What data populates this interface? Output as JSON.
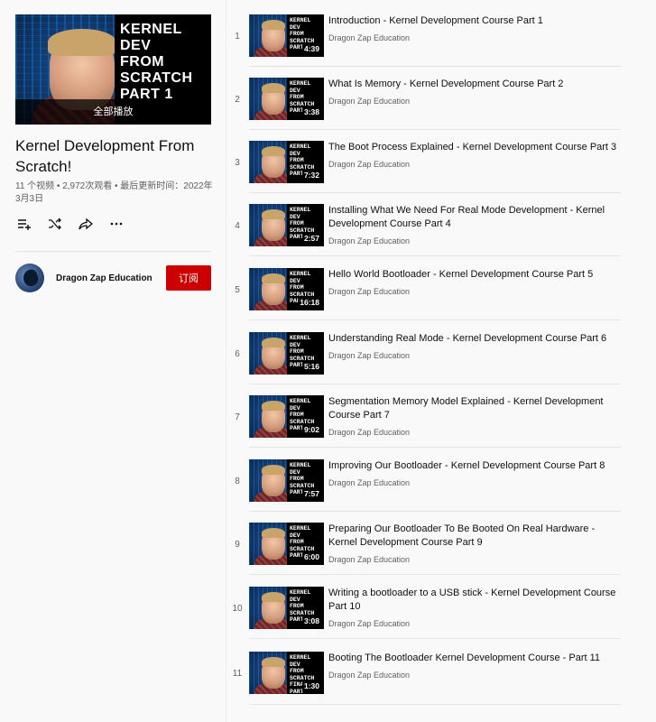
{
  "playlist": {
    "hero_text": "KERNEL\nDEV\nFROM\nSCRATCH\nPART 1",
    "play_all": "全部播放",
    "title": "Kernel Development From Scratch!",
    "meta": "11 个视频 • 2,972次观看 • 最后更新时间：2022年3月3日",
    "actions": [
      "save-to-playlist-icon",
      "shuffle-icon",
      "share-icon",
      "more-icon"
    ],
    "channel": "Dragon Zap Education",
    "subscribe": "订阅"
  },
  "videos": [
    {
      "index": "1",
      "title": "Introduction - Kernel Development Course Part 1",
      "channel": "Dragon Zap Education",
      "duration": "4:39",
      "thumb_text": "KERNEL\nDEV\nFROM\nSCRATCH\nPART 1"
    },
    {
      "index": "2",
      "title": "What Is Memory - Kernel Development Course Part 2",
      "channel": "Dragon Zap Education",
      "duration": "3:38",
      "thumb_text": "KERNEL\nDEV\nFROM\nSCRATCH\nPART 2"
    },
    {
      "index": "3",
      "title": "The Boot Process Explained - Kernel Development Course Part 3",
      "channel": "Dragon Zap Education",
      "duration": "7:32",
      "thumb_text": "KERNEL\nDEV\nFROM\nSCRATCH\nPART 3"
    },
    {
      "index": "4",
      "title": "Installing What We Need For Real Mode Development - Kernel Development Course Part 4",
      "channel": "Dragon Zap Education",
      "duration": "2:57",
      "thumb_text": "KERNEL\nDEV\nFROM\nSCRATCH\nPART 4"
    },
    {
      "index": "5",
      "title": "Hello World Bootloader - Kernel Development Course Part 5",
      "channel": "Dragon Zap Education",
      "duration": "16:18",
      "thumb_text": "KERNEL\nDEV\nFROM\nSCRATCH\nPART 5"
    },
    {
      "index": "6",
      "title": "Understanding Real Mode - Kernel Development Course Part 6",
      "channel": "Dragon Zap Education",
      "duration": "5:16",
      "thumb_text": "KERNEL\nDEV\nFROM\nSCRATCH\nPART 6"
    },
    {
      "index": "7",
      "title": "Segmentation Memory Model Explained - Kernel Development Course Part 7",
      "channel": "Dragon Zap Education",
      "duration": "9:02",
      "thumb_text": "KERNEL\nDEV\nFROM\nSCRATCH\nPART 7"
    },
    {
      "index": "8",
      "title": "Improving Our Bootloader - Kernel Development Course Part 8",
      "channel": "Dragon Zap Education",
      "duration": "7:57",
      "thumb_text": "KERNEL\nDEV\nFROM\nSCRATCH\nPART 8"
    },
    {
      "index": "9",
      "title": "Preparing Our Bootloader To Be Booted On Real Hardware - Kernel Development Course Part 9",
      "channel": "Dragon Zap Education",
      "duration": "6:00",
      "thumb_text": "KERNEL\nDEV\nFROM\nSCRATCH\nPART 9"
    },
    {
      "index": "10",
      "title": "Writing a bootloader to a USB stick - Kernel Development Course Part 10",
      "channel": "Dragon Zap Education",
      "duration": "3:08",
      "thumb_text": "KERNEL\nDEV\nFROM\nSCRATCH\nPART 10"
    },
    {
      "index": "11",
      "title": "Booting The Bootloader Kernel Development Course - Part 11",
      "channel": "Dragon Zap Education",
      "duration": "1:30",
      "thumb_text": "KERNEL\nDEV\nFROM\nSCRATCH\nFINAL\nPART"
    }
  ]
}
